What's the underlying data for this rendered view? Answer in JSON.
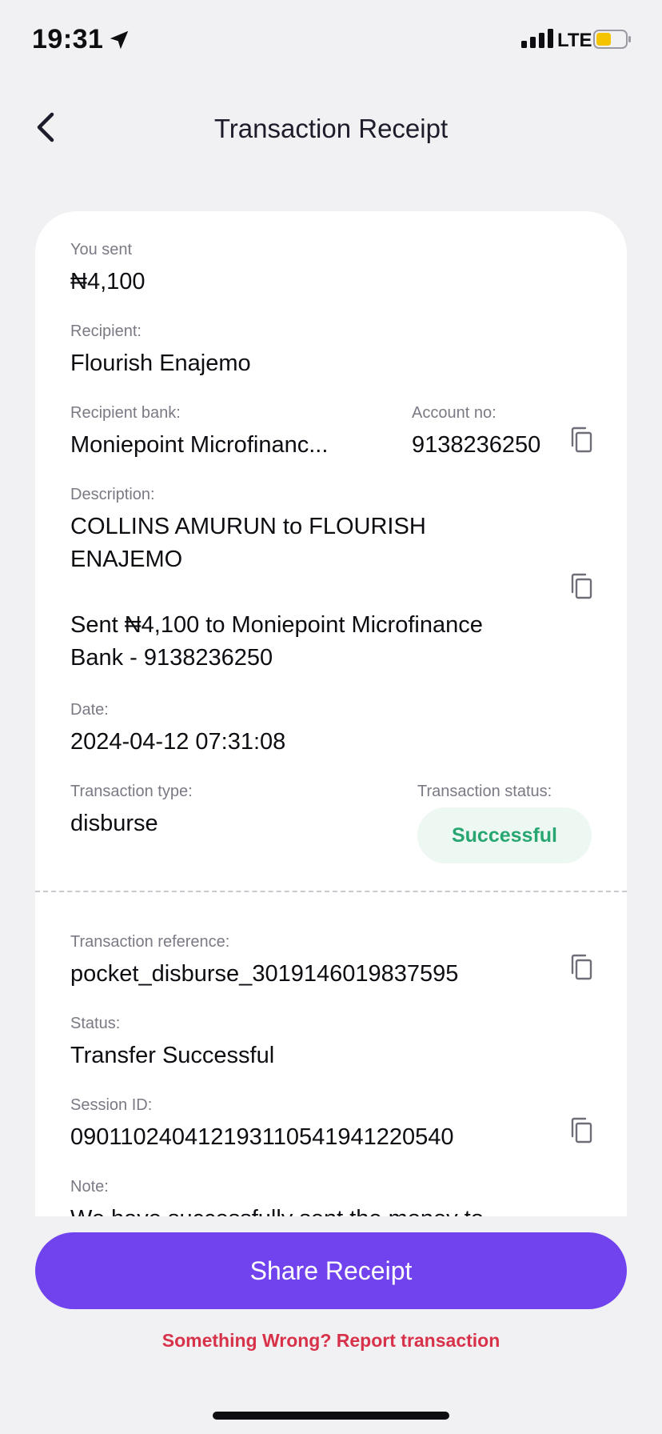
{
  "status_bar": {
    "time": "19:31",
    "network": "LTE"
  },
  "header": {
    "title": "Transaction Receipt"
  },
  "receipt": {
    "you_sent": {
      "label": "You sent",
      "value": "₦4,100"
    },
    "recipient": {
      "label": "Recipient:",
      "value": "Flourish Enajemo"
    },
    "recipient_bank": {
      "label": "Recipient bank:",
      "value": "Moniepoint Microfinanc..."
    },
    "account_no": {
      "label": "Account no:",
      "value": "9138236250"
    },
    "description": {
      "label": "Description:",
      "line1": "COLLINS AMURUN to FLOURISH",
      "line2": "ENAJEMO",
      "line3": "Sent ₦4,100 to Moniepoint Microfinance",
      "line4": "Bank - 9138236250"
    },
    "date": {
      "label": "Date:",
      "value": "2024-04-12 07:31:08"
    },
    "transaction_type": {
      "label": "Transaction type:",
      "value": "disburse"
    },
    "transaction_status": {
      "label": "Transaction status:",
      "value": "Successful"
    },
    "transaction_reference": {
      "label": "Transaction reference:",
      "value": "pocket_disburse_3019146019837595"
    },
    "status": {
      "label": "Status:",
      "value": "Transfer Successful"
    },
    "session_id": {
      "label": "Session ID:",
      "value": "090110240412193110541941220540"
    },
    "note": {
      "label": "Note:",
      "value": "We have successfully sent the money to"
    }
  },
  "actions": {
    "share_label": "Share Receipt",
    "report_label": "Something Wrong? Report transaction"
  },
  "colors": {
    "accent": "#7043ef",
    "success": "#27a672",
    "danger": "#d8324a",
    "battery": "#f5c400"
  }
}
